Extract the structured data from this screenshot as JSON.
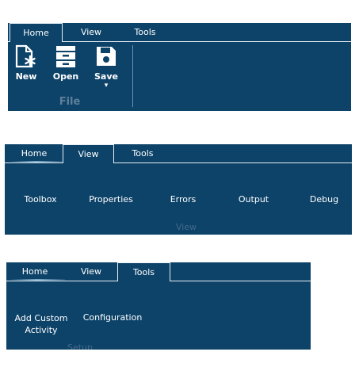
{
  "ribbon1": {
    "tabs": {
      "home": "Home",
      "view": "View",
      "tools": "Tools"
    },
    "buttons": {
      "new": "New",
      "open": "Open",
      "save": "Save"
    },
    "dropdown_arrow": "▾",
    "group_label": "File"
  },
  "ribbon2": {
    "tabs": {
      "home": "Home",
      "view": "View",
      "tools": "Tools"
    },
    "buttons": {
      "toolbox": "Toolbox",
      "properties": "Properties",
      "errors": "Errors",
      "output": "Output",
      "debug": "Debug"
    },
    "group_label": "View"
  },
  "ribbon3": {
    "tabs": {
      "home": "Home",
      "view": "View",
      "tools": "Tools"
    },
    "buttons": {
      "add_custom_line1": "Add Custom",
      "add_custom_line2": "Activity",
      "configuration": "Configuration"
    },
    "group_label": "Setup"
  },
  "colors": {
    "ribbon_bg": "#0d4369",
    "tab_border": "#e6eef5",
    "group_label": "#5f7f9b"
  },
  "icons": {
    "new": "new-document-icon",
    "open": "file-cabinet-icon",
    "save": "floppy-disk-icon"
  }
}
